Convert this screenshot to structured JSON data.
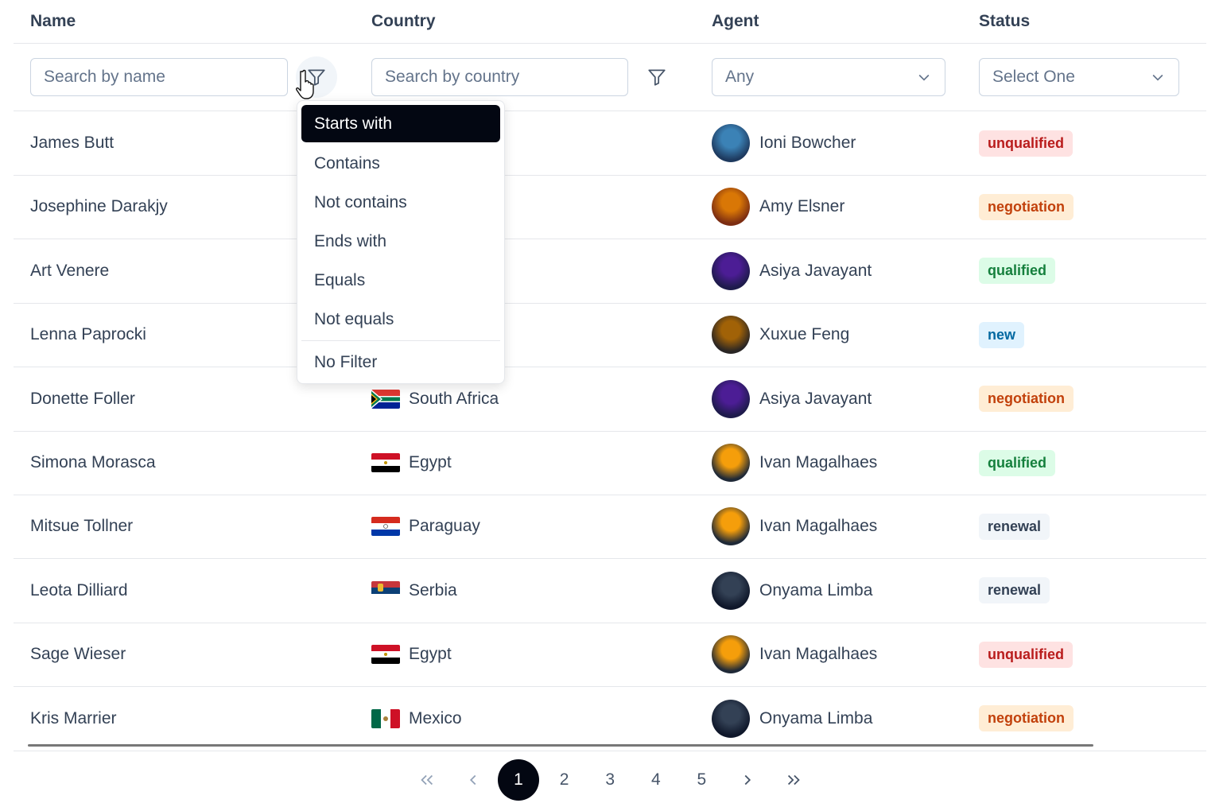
{
  "columns": {
    "name": "Name",
    "country": "Country",
    "agent": "Agent",
    "status": "Status"
  },
  "filters": {
    "name_placeholder": "Search by name",
    "country_placeholder": "Search by country",
    "agent_value": "Any",
    "status_value": "Select One"
  },
  "match_menu": {
    "options": [
      "Starts with",
      "Contains",
      "Not contains",
      "Ends with",
      "Equals",
      "Not equals"
    ],
    "selected": "Starts with",
    "clear": "No Filter"
  },
  "rows": [
    {
      "name": "James Butt",
      "country": "",
      "flag": "",
      "agent": "Ioni Bowcher",
      "status": "unqualified"
    },
    {
      "name": "Josephine Darakjy",
      "country": "",
      "flag": "",
      "agent": "Amy Elsner",
      "status": "negotiation"
    },
    {
      "name": "Art Venere",
      "country": "",
      "flag": "",
      "agent": "Asiya Javayant",
      "status": "qualified"
    },
    {
      "name": "Lenna Paprocki",
      "country": "",
      "flag": "",
      "agent": "Xuxue Feng",
      "status": "new"
    },
    {
      "name": "Donette Foller",
      "country": "South Africa",
      "flag": "za",
      "agent": "Asiya Javayant",
      "status": "negotiation"
    },
    {
      "name": "Simona Morasca",
      "country": "Egypt",
      "flag": "eg",
      "agent": "Ivan Magalhaes",
      "status": "qualified"
    },
    {
      "name": "Mitsue Tollner",
      "country": "Paraguay",
      "flag": "py",
      "agent": "Ivan Magalhaes",
      "status": "renewal"
    },
    {
      "name": "Leota Dilliard",
      "country": "Serbia",
      "flag": "rs",
      "agent": "Onyama Limba",
      "status": "renewal"
    },
    {
      "name": "Sage Wieser",
      "country": "Egypt",
      "flag": "eg",
      "agent": "Ivan Magalhaes",
      "status": "unqualified"
    },
    {
      "name": "Kris Marrier",
      "country": "Mexico",
      "flag": "mx",
      "agent": "Onyama Limba",
      "status": "negotiation"
    }
  ],
  "status_colors": {
    "unqualified": {
      "bg": "#fee2e2",
      "fg": "#b91c1c"
    },
    "negotiation": {
      "bg": "#ffedd5",
      "fg": "#c2410c"
    },
    "qualified": {
      "bg": "#dcfce7",
      "fg": "#15803d"
    },
    "new": {
      "bg": "#e0f2fe",
      "fg": "#0369a1"
    },
    "renewal": {
      "bg": "#f1f5f9",
      "fg": "#334155"
    }
  },
  "agent_avatars": {
    "Ioni Bowcher": [
      "#3b82b6",
      "#1e3a5f"
    ],
    "Amy Elsner": [
      "#d97706",
      "#7c2d12"
    ],
    "Asiya Javayant": [
      "#4c1d95",
      "#1e1b4b"
    ],
    "Xuxue Feng": [
      "#a16207",
      "#292524"
    ],
    "Ivan Magalhaes": [
      "#f59e0b",
      "#1f2937"
    ],
    "Onyama Limba": [
      "#334155",
      "#0f172a"
    ]
  },
  "pagination": {
    "pages": [
      "1",
      "2",
      "3",
      "4",
      "5"
    ],
    "current": "1"
  }
}
